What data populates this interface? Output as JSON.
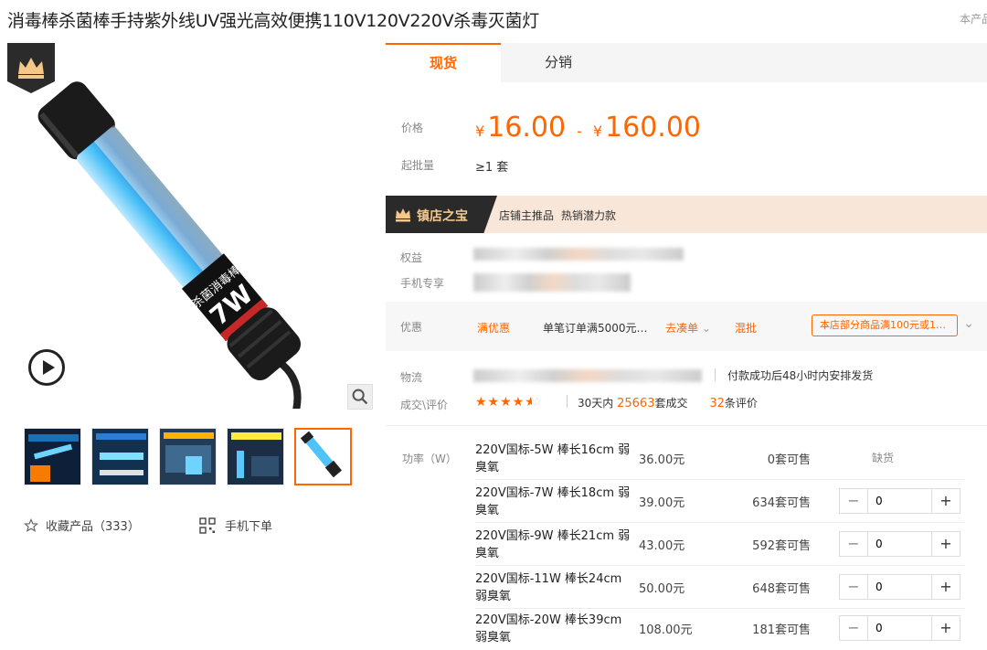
{
  "title": "消毒棒杀菌棒手持紫外线UV强光高效便携110V120V220V杀毒灭菌灯",
  "corner_note": "本产品",
  "product_label": "杀菌消毒棒",
  "product_power": "7W",
  "tabs": [
    {
      "label": "现货",
      "active": true
    },
    {
      "label": "分销",
      "active": false
    }
  ],
  "price": {
    "label": "价格",
    "currency": "¥",
    "min": "16.00",
    "dash": "-",
    "max": "160.00"
  },
  "moq": {
    "label": "起批量",
    "value": "≥1 套"
  },
  "banner": {
    "title": "镇店之宝",
    "tags": [
      "店铺主推品",
      "热销潜力款"
    ]
  },
  "rights_label": "权益",
  "mobile_exclusive_label": "手机专享",
  "promo": {
    "label": "优惠",
    "type": "满优惠",
    "desc": "单笔订单满5000元…",
    "collect": "去凑单",
    "mix": "混批",
    "tag": "本店部分商品满100元或1…"
  },
  "logistics": {
    "label": "物流",
    "note": "付款成功后48小时内安排发货"
  },
  "deals": {
    "label": "成交\\评价",
    "rating": 4.5,
    "prefix": "30天内",
    "sold": "25663",
    "sold_suffix": "套成交",
    "reviews": "32",
    "reviews_suffix": "条评价"
  },
  "favorite": {
    "label": "收藏产品（333）"
  },
  "mobile_order": {
    "label": "手机下单"
  },
  "sku": {
    "label": "功率（W）",
    "rows": [
      {
        "name": "220V国标-5W 棒长16cm 弱臭氧",
        "price": "36.00元",
        "stock": "0套可售",
        "out": "缺货",
        "qty": null
      },
      {
        "name": "220V国标-7W 棒长18cm 弱臭氧",
        "price": "39.00元",
        "stock": "634套可售",
        "out": null,
        "qty": "0"
      },
      {
        "name": "220V国标-9W 棒长21cm 弱臭氧",
        "price": "43.00元",
        "stock": "592套可售",
        "out": null,
        "qty": "0"
      },
      {
        "name": "220V国标-11W 棒长24cm 弱臭氧",
        "price": "50.00元",
        "stock": "648套可售",
        "out": null,
        "qty": "0"
      },
      {
        "name": "220V国标-20W 棒长39cm 弱臭氧",
        "price": "108.00元",
        "stock": "181套可售",
        "out": null,
        "qty": "0"
      }
    ]
  },
  "colors": {
    "accent": "#ff6600",
    "banner_bg": "#f8e7d8",
    "tube_glow": "#4fc3f7"
  }
}
